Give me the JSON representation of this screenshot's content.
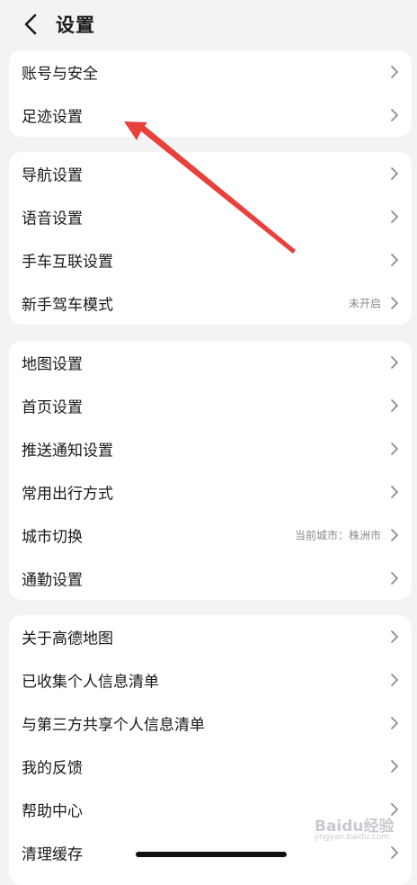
{
  "header": {
    "title": "设置",
    "back_icon": "chevron-left-icon"
  },
  "groups": [
    {
      "items": [
        {
          "label": "账号与安全",
          "value": ""
        },
        {
          "label": "足迹设置",
          "value": ""
        }
      ]
    },
    {
      "items": [
        {
          "label": "导航设置",
          "value": ""
        },
        {
          "label": "语音设置",
          "value": ""
        },
        {
          "label": "手车互联设置",
          "value": ""
        },
        {
          "label": "新手驾车模式",
          "value": "未开启"
        }
      ]
    },
    {
      "items": [
        {
          "label": "地图设置",
          "value": ""
        },
        {
          "label": "首页设置",
          "value": ""
        },
        {
          "label": "推送通知设置",
          "value": ""
        },
        {
          "label": "常用出行方式",
          "value": ""
        },
        {
          "label": "城市切换",
          "value": "当前城市：株洲市"
        },
        {
          "label": "通勤设置",
          "value": ""
        }
      ]
    },
    {
      "items": [
        {
          "label": "关于高德地图",
          "value": ""
        },
        {
          "label": "已收集个人信息清单",
          "value": ""
        },
        {
          "label": "与第三方共享个人信息清单",
          "value": ""
        },
        {
          "label": "我的反馈",
          "value": ""
        },
        {
          "label": "帮助中心",
          "value": ""
        },
        {
          "label": "清理缓存",
          "value": ""
        }
      ]
    }
  ],
  "annotation": {
    "color": "#e8413c",
    "icon": "red-arrow-annotation"
  },
  "watermark": {
    "brand": "Baidu经验",
    "url": "jingyan.baidu.com"
  }
}
